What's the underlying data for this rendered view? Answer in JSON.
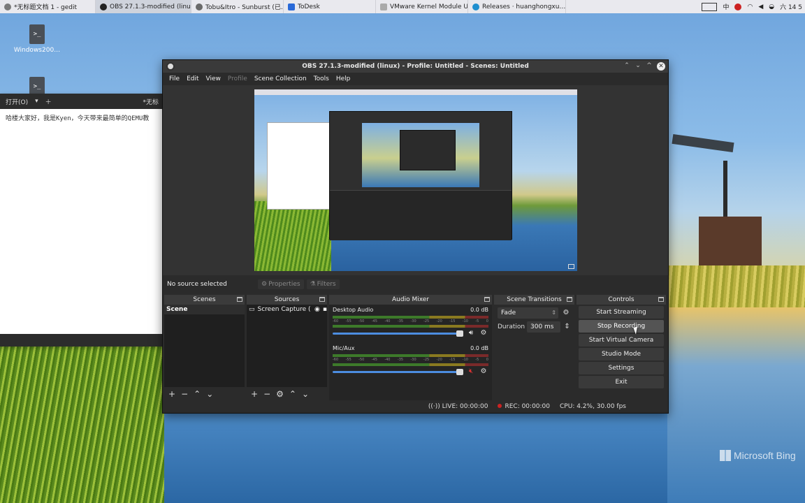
{
  "taskbar": {
    "tasks": [
      {
        "label": "*无标题文档 1 - gedit"
      },
      {
        "label": "OBS 27.1.3-modified (linu…"
      },
      {
        "label": "Tobu&Itro - Sunburst (已…"
      },
      {
        "label": "ToDesk"
      },
      {
        "label": "VMware Kernel Module U…"
      },
      {
        "label": "Releases · huanghongxu…"
      }
    ],
    "ime": "中",
    "clock": "六 14 5"
  },
  "desktop": {
    "icons": [
      {
        "label": "Windows200…"
      },
      {
        "label": ""
      }
    ],
    "watermark": "Microsoft Bing"
  },
  "gedit": {
    "open_label": "打开(O)",
    "tab_title": "*无标",
    "text": "哈楼大家好，我是Kyen，今天带来最简单的QEMU教"
  },
  "obs": {
    "title": "OBS 27.1.3-modified (linux) - Profile: Untitled - Scenes: Untitled",
    "menu": [
      "File",
      "Edit",
      "View",
      "Profile",
      "Scene Collection",
      "Tools",
      "Help"
    ],
    "no_source": "No source selected",
    "properties_label": "Properties",
    "filters_label": "Filters",
    "scenes": {
      "title": "Scenes",
      "items": [
        "Scene"
      ]
    },
    "sources": {
      "title": "Sources",
      "items": [
        "Screen Capture ("
      ]
    },
    "mixer": {
      "title": "Audio Mixer",
      "channels": [
        {
          "name": "Desktop Audio",
          "db": "0.0 dB",
          "muted": false
        },
        {
          "name": "Mic/Aux",
          "db": "0.0 dB",
          "muted": true
        }
      ],
      "ticks": [
        "-60",
        "-55",
        "-50",
        "-45",
        "-40",
        "-35",
        "-30",
        "-25",
        "-20",
        "-15",
        "-10",
        "-5",
        "0"
      ]
    },
    "transitions": {
      "title": "Scene Transitions",
      "selected": "Fade",
      "duration_label": "Duration",
      "duration_value": "300 ms"
    },
    "controls": {
      "title": "Controls",
      "buttons": [
        "Start Streaming",
        "Stop Recording",
        "Start Virtual Camera",
        "Studio Mode",
        "Settings",
        "Exit"
      ]
    },
    "status": {
      "live": "LIVE: 00:00:00",
      "rec": "REC: 00:00:00",
      "cpu": "CPU: 4.2%, 30.00 fps"
    }
  },
  "colors": {
    "obs_bg": "#2b2b2b",
    "accent_slider": "#4c8de0",
    "rec_red": "#cc2222"
  }
}
